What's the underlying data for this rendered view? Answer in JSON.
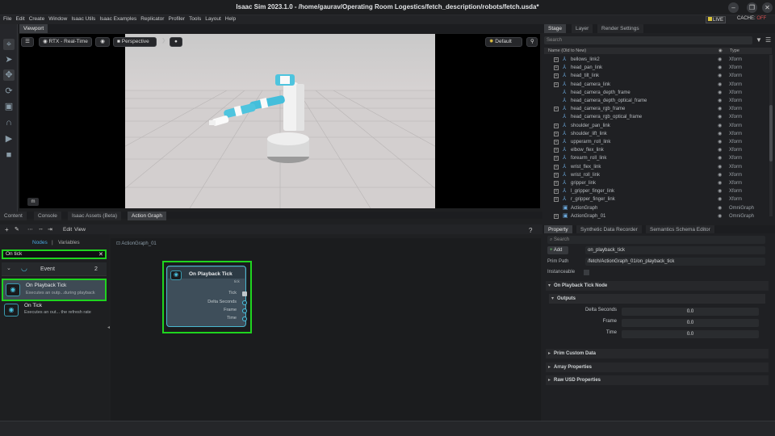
{
  "window": {
    "title": "Isaac Sim 2023.1.0 - /home/gaurav/Operating Room Logestics/fetch_description/robots/fetch.usda*"
  },
  "menu": [
    "File",
    "Edit",
    "Create",
    "Window",
    "Isaac Utils",
    "Isaac Examples",
    "Replicator",
    "Profiler",
    "Tools",
    "Layout",
    "Help"
  ],
  "status": {
    "live": "LIVE",
    "cache": "CACHE:",
    "cache_state": "OFF"
  },
  "viewport": {
    "tab": "Viewport",
    "renderer": "RTX - Real-Time",
    "camera": "Perspective",
    "lighting": "Default",
    "badge": "m"
  },
  "stage": {
    "tabs": [
      "Stage",
      "Layer",
      "Render Settings"
    ],
    "search_placeholder": "Search",
    "col_name": "Name (Old to New)",
    "col_type": "Type",
    "rows": [
      {
        "name": "bellows_link2",
        "type": "Xform",
        "exp": true
      },
      {
        "name": "head_pan_link",
        "type": "Xform",
        "exp": true
      },
      {
        "name": "head_tilt_link",
        "type": "Xform",
        "exp": true
      },
      {
        "name": "head_camera_link",
        "type": "Xform",
        "exp": true
      },
      {
        "name": "head_camera_depth_frame",
        "type": "Xform",
        "exp": false
      },
      {
        "name": "head_camera_depth_optical_frame",
        "type": "Xform",
        "exp": false
      },
      {
        "name": "head_camera_rgb_frame",
        "type": "Xform",
        "exp": true
      },
      {
        "name": "head_camera_rgb_optical_frame",
        "type": "Xform",
        "exp": false
      },
      {
        "name": "shoulder_pan_link",
        "type": "Xform",
        "exp": true
      },
      {
        "name": "shoulder_lift_link",
        "type": "Xform",
        "exp": true
      },
      {
        "name": "upperarm_roll_link",
        "type": "Xform",
        "exp": true
      },
      {
        "name": "elbow_flex_link",
        "type": "Xform",
        "exp": true
      },
      {
        "name": "forearm_roll_link",
        "type": "Xform",
        "exp": true
      },
      {
        "name": "wrist_flex_link",
        "type": "Xform",
        "exp": true
      },
      {
        "name": "wrist_roll_link",
        "type": "Xform",
        "exp": true
      },
      {
        "name": "gripper_link",
        "type": "Xform",
        "exp": true
      },
      {
        "name": "l_gripper_finger_link",
        "type": "Xform",
        "exp": true
      },
      {
        "name": "r_gripper_finger_link",
        "type": "Xform",
        "exp": true
      },
      {
        "name": "ActionGraph",
        "type": "OmniGraph",
        "exp": false
      },
      {
        "name": "ActionGraph_01",
        "type": "OmniGraph",
        "exp": true
      }
    ]
  },
  "bottom_tabs": [
    "Content",
    "Console",
    "Isaac Assets (Beta)",
    "Action Graph"
  ],
  "action_graph": {
    "toolbar_edit": "Edit",
    "toolbar_view": "View",
    "help": "?",
    "graph_name": "ActionGraph_01",
    "nodes_tab": "Nodes",
    "variables_tab": "Variables",
    "search_value": "On tick",
    "category": {
      "name": "Event",
      "count": "2"
    },
    "results": [
      {
        "title": "On Playback Tick",
        "desc": "Executes an outp...during playback"
      },
      {
        "title": "On Tick",
        "desc": "Executes an out... the refresh rate"
      }
    ],
    "node": {
      "title": "On Playback Tick",
      "tag": "tick",
      "ports": [
        "Tick",
        "Delta Seconds",
        "Frame",
        "Time"
      ]
    }
  },
  "property": {
    "tabs": [
      "Property",
      "Synthetic Data Recorder",
      "Semantics Schema Editor"
    ],
    "search_placeholder": "Search",
    "add_label": "Add",
    "prim_name": "on_playback_tick",
    "prim_path_label": "Prim Path",
    "prim_path": "/fetch/ActionGraph_01/on_playback_tick",
    "instanceable_label": "Instanceable",
    "node_section": "On Playback Tick Node",
    "outputs_section": "Outputs",
    "outputs": [
      {
        "label": "Delta Seconds",
        "value": "0.0"
      },
      {
        "label": "Frame",
        "value": "0.0"
      },
      {
        "label": "Time",
        "value": "0.0"
      }
    ],
    "sections": [
      "Prim Custom Data",
      "Array Properties",
      "Raw USD Properties"
    ]
  }
}
